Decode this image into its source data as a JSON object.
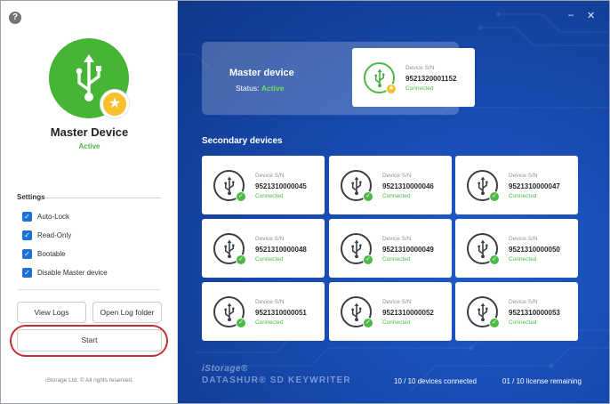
{
  "left_panel": {
    "help_label": "?",
    "device_title": "Master Device",
    "device_status": "Active",
    "settings_label": "Settings",
    "settings": [
      {
        "label": "Auto-Lock",
        "checked": true
      },
      {
        "label": "Read-Only",
        "checked": true
      },
      {
        "label": "Bootable",
        "checked": true
      },
      {
        "label": "Disable Master device",
        "checked": true
      }
    ],
    "view_logs_label": "View Logs",
    "open_log_folder_label": "Open Log folder",
    "start_label": "Start",
    "copyright": "iStorage Ltd. © All rights reserved."
  },
  "window_controls": {
    "minimize": "–",
    "close": "✕"
  },
  "master_panel": {
    "title": "Master device",
    "status_prefix": "Status: ",
    "status_value": "Active",
    "card": {
      "label": "Device S/N",
      "serial": "9521320001152",
      "status": "Connected"
    }
  },
  "secondary": {
    "title": "Secondary devices",
    "devices": [
      {
        "label": "Device S/N",
        "serial": "9521310000045",
        "status": "Connected"
      },
      {
        "label": "Device S/N",
        "serial": "9521310000046",
        "status": "Connected"
      },
      {
        "label": "Device S/N",
        "serial": "9521310000047",
        "status": "Connected"
      },
      {
        "label": "Device S/N",
        "serial": "9521310000048",
        "status": "Connected"
      },
      {
        "label": "Device S/N",
        "serial": "9521310000049",
        "status": "Connected"
      },
      {
        "label": "Device S/N",
        "serial": "9521310000050",
        "status": "Connected"
      },
      {
        "label": "Device S/N",
        "serial": "9521310000051",
        "status": "Connected"
      },
      {
        "label": "Device S/N",
        "serial": "9521310000052",
        "status": "Connected"
      },
      {
        "label": "Device S/N",
        "serial": "9521310000053",
        "status": "Connected"
      }
    ]
  },
  "footer": {
    "brand_line1": "iStorage®",
    "brand_line2": "DATASHUR® SD KEYWRITER",
    "devices_connected": "10 / 10 devices connected",
    "license_remaining": "01 / 10 license remaining"
  },
  "colors": {
    "accent_blue": "#1a72d6",
    "status_green": "#4cb944",
    "star_yellow": "#f5c02c",
    "highlight_red": "#c52d33",
    "panel_blue": "#174aaf"
  },
  "icons": [
    "help-icon",
    "usb-icon",
    "star-icon",
    "check-icon",
    "minimize-icon",
    "close-icon"
  ]
}
